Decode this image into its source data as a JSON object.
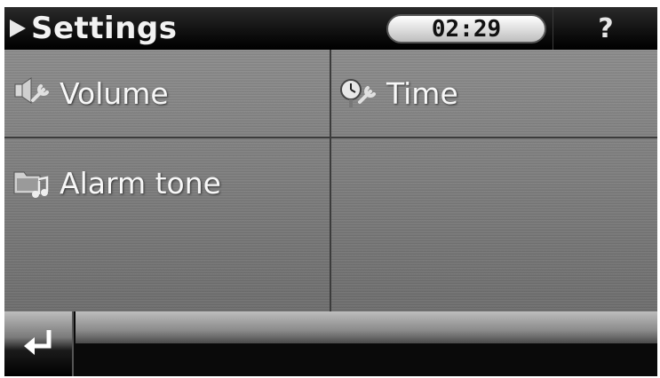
{
  "header": {
    "title": "Settings",
    "clock": "02:29",
    "help_label": "?"
  },
  "menu": {
    "items": [
      {
        "label": "Volume",
        "icon": "volume-settings-icon"
      },
      {
        "label": "Time",
        "icon": "clock-settings-icon"
      },
      {
        "label": "Alarm tone",
        "icon": "alarm-tone-folder-icon"
      }
    ]
  },
  "footer": {
    "back_icon": "return-arrow-icon"
  },
  "colors": {
    "tile_background": "#7d7d7d",
    "header_background": "#0b0b0b",
    "clock_pill": "#e6e6e6",
    "text": "#f7f7f7"
  }
}
